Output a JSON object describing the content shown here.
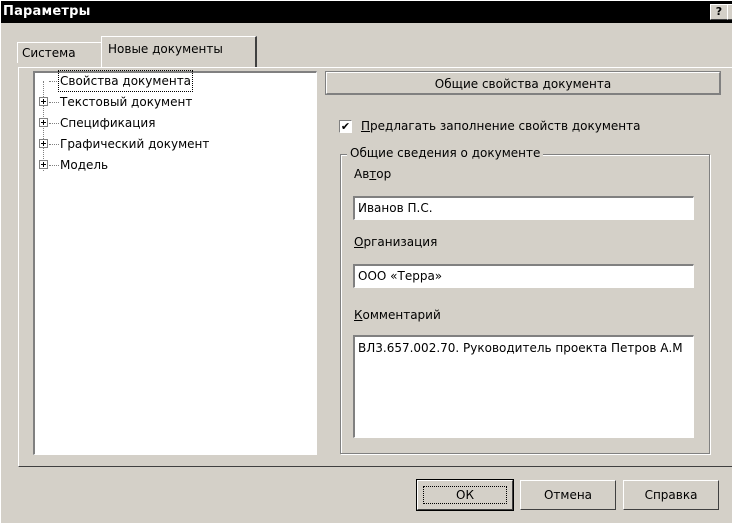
{
  "window": {
    "title": "Параметры",
    "help_btn": "?",
    "close_btn": "✕"
  },
  "tabs": [
    {
      "label": "Система",
      "active": false
    },
    {
      "label": "Новые документы",
      "active": true
    }
  ],
  "tree": {
    "items": [
      {
        "label": "Свойства документа",
        "selected": true,
        "expandable": false
      },
      {
        "label": "Текстовый документ",
        "selected": false,
        "expandable": true
      },
      {
        "label": "Спецификация",
        "selected": false,
        "expandable": true
      },
      {
        "label": "Графический документ",
        "selected": false,
        "expandable": true
      },
      {
        "label": "Модель",
        "selected": false,
        "expandable": true
      }
    ]
  },
  "properties": {
    "header": "Общие свойства документа",
    "checkbox": {
      "checked": true,
      "mark": "✔",
      "label_hotkey": "П",
      "label_rest": "редлагать заполнение свойств документа"
    },
    "group": {
      "legend": "Общие сведения о документе",
      "author_label_a": "Ав",
      "author_label_hotkey": "т",
      "author_label_b": "ор",
      "author_value": "Иванов П.С.",
      "org_label_hotkey": "О",
      "org_label_rest": "рганизация",
      "org_value": "ООО «Терра»",
      "comment_label_hotkey": "К",
      "comment_label_rest": "омментарий",
      "comment_value": "ВЛ3.657.002.70. Руководитель проекта Петров А.М"
    }
  },
  "buttons": {
    "ok": "ОК",
    "cancel": "Отмена",
    "help": "Справка"
  }
}
